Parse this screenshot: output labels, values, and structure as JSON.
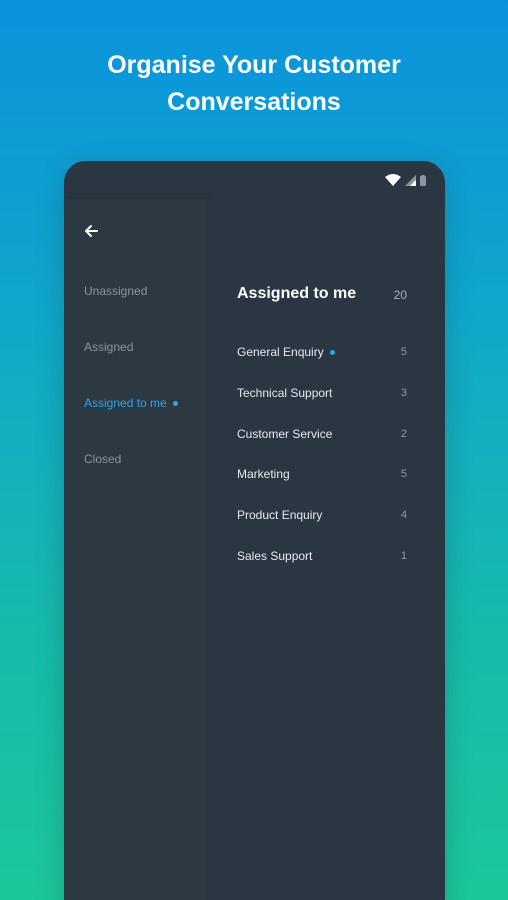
{
  "headline": {
    "line1": "Organise Your Customer",
    "line2": "Conversations"
  },
  "status_bar": {
    "icons": [
      "wifi-icon",
      "cell-signal-icon",
      "battery-icon"
    ]
  },
  "sidebar": {
    "back_icon": "arrow-left-icon",
    "items": [
      {
        "label": "Unassigned",
        "active": false
      },
      {
        "label": "Assigned",
        "active": false
      },
      {
        "label": "Assigned to me",
        "active": true,
        "indicator": true
      },
      {
        "label": "Closed",
        "active": false
      }
    ]
  },
  "main": {
    "title": "Assigned to me",
    "count": "20",
    "rows": [
      {
        "label": "General Enquiry",
        "count": "5",
        "indicator": true
      },
      {
        "label": "Technical Support",
        "count": "3"
      },
      {
        "label": "Customer Service",
        "count": "2"
      },
      {
        "label": "Marketing",
        "count": "5"
      },
      {
        "label": "Product Enquiry",
        "count": "4"
      },
      {
        "label": "Sales Support",
        "count": "1"
      }
    ]
  },
  "colors": {
    "accent": "#2ea6ea",
    "panel_bg": "#2a3641",
    "gradient_top": "#0a93dc",
    "gradient_bottom": "#1bc79a"
  }
}
